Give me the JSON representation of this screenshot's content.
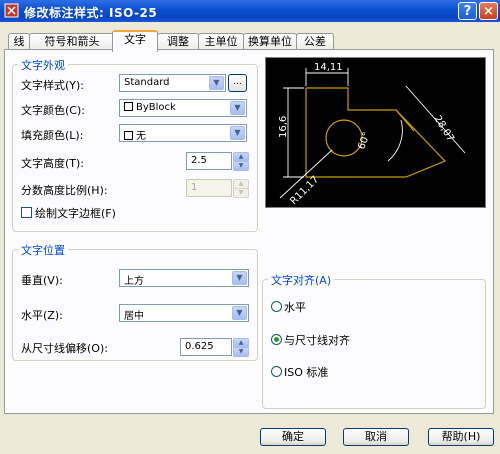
{
  "window": {
    "title": "修改标注样式: ISO-25",
    "help_label": "?",
    "close_label": "×"
  },
  "tabs": [
    {
      "label": "线",
      "active": false
    },
    {
      "label": "符号和箭头",
      "active": false
    },
    {
      "label": "文字",
      "active": true
    },
    {
      "label": "调整",
      "active": false
    },
    {
      "label": "主单位",
      "active": false
    },
    {
      "label": "换算单位",
      "active": false
    },
    {
      "label": "公差",
      "active": false
    }
  ],
  "text_appearance": {
    "title": "文字外观",
    "style_label": "文字样式(Y):",
    "style_value": "Standard",
    "browse_label": "...",
    "color_label": "文字颜色(C):",
    "color_value": "ByBlock",
    "fill_label": "填充颜色(L):",
    "fill_value": "无",
    "height_label": "文字高度(T):",
    "height_value": "2.5",
    "fraction_label": "分数高度比例(H):",
    "fraction_value": "1",
    "frame_label": "绘制文字边框(F)",
    "frame_checked": false
  },
  "text_placement": {
    "title": "文字位置",
    "vertical_label": "垂直(V):",
    "vertical_value": "上方",
    "horizontal_label": "水平(Z):",
    "horizontal_value": "居中",
    "offset_label": "从尺寸线偏移(O):",
    "offset_value": "0.625"
  },
  "text_alignment": {
    "title": "文字对齐(A)",
    "options": [
      {
        "label": "水平",
        "selected": false
      },
      {
        "label": "与尺寸线对齐",
        "selected": true
      },
      {
        "label": "ISO 标准",
        "selected": false
      }
    ]
  },
  "preview": {
    "dims": [
      "14,11",
      "16,6",
      "28,07",
      "60°",
      "R11,17"
    ]
  },
  "buttons": {
    "ok": "确定",
    "cancel": "取消",
    "help": "帮助(H)"
  },
  "colors": {
    "title_bar": "#0a4fd0",
    "group_title": "#0046d5",
    "preview_bg": "#000000",
    "preview_shape": "#c8a000"
  }
}
